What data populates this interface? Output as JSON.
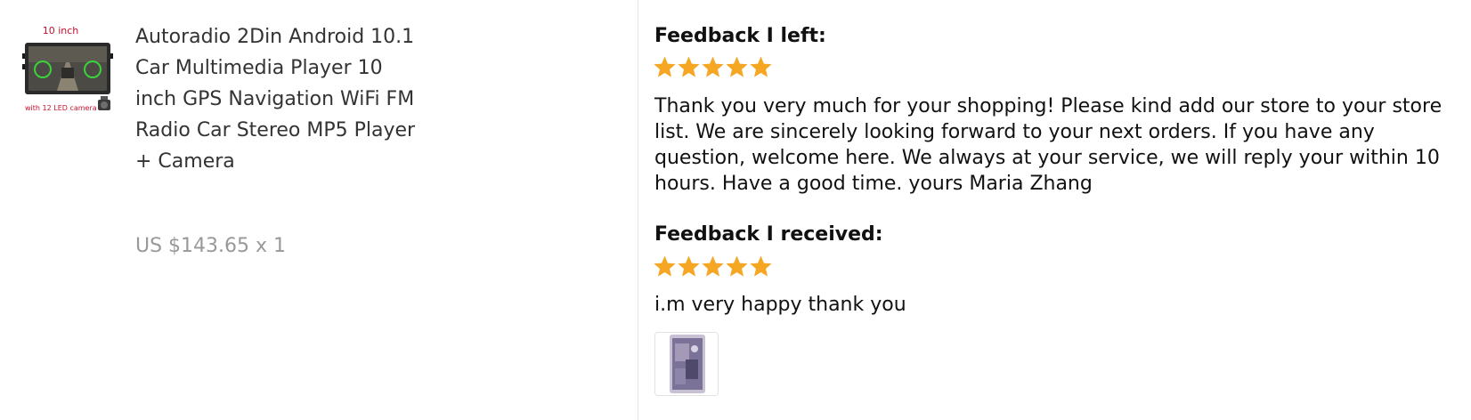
{
  "product": {
    "image_top_label": "10 inch",
    "image_bottom_label": "with 12 LED camera",
    "title": "Autoradio 2Din Android 10.1 Car Multimedia Player 10 inch GPS Navigation WiFi FM Radio Car Stereo MP5 Player + Camera",
    "price": "US $143.65",
    "quantity": "x 1"
  },
  "feedback_left": {
    "heading": "Feedback I left:",
    "rating": 5,
    "text": "Thank you very much for your shopping! Please kind add our store to your store list. We are sincerely looking forward to your next orders. If you have any question, welcome here. We always at your service, we will reply your within 10 hours. Have a good time. yours Maria Zhang"
  },
  "feedback_received": {
    "heading": "Feedback I received:",
    "rating": 5,
    "text": "i.m very happy thank you",
    "photo_icon": "review-photo-thumbnail"
  },
  "colors": {
    "star": "#f5a623",
    "price": "#999999",
    "image_label": "#c8102e"
  }
}
